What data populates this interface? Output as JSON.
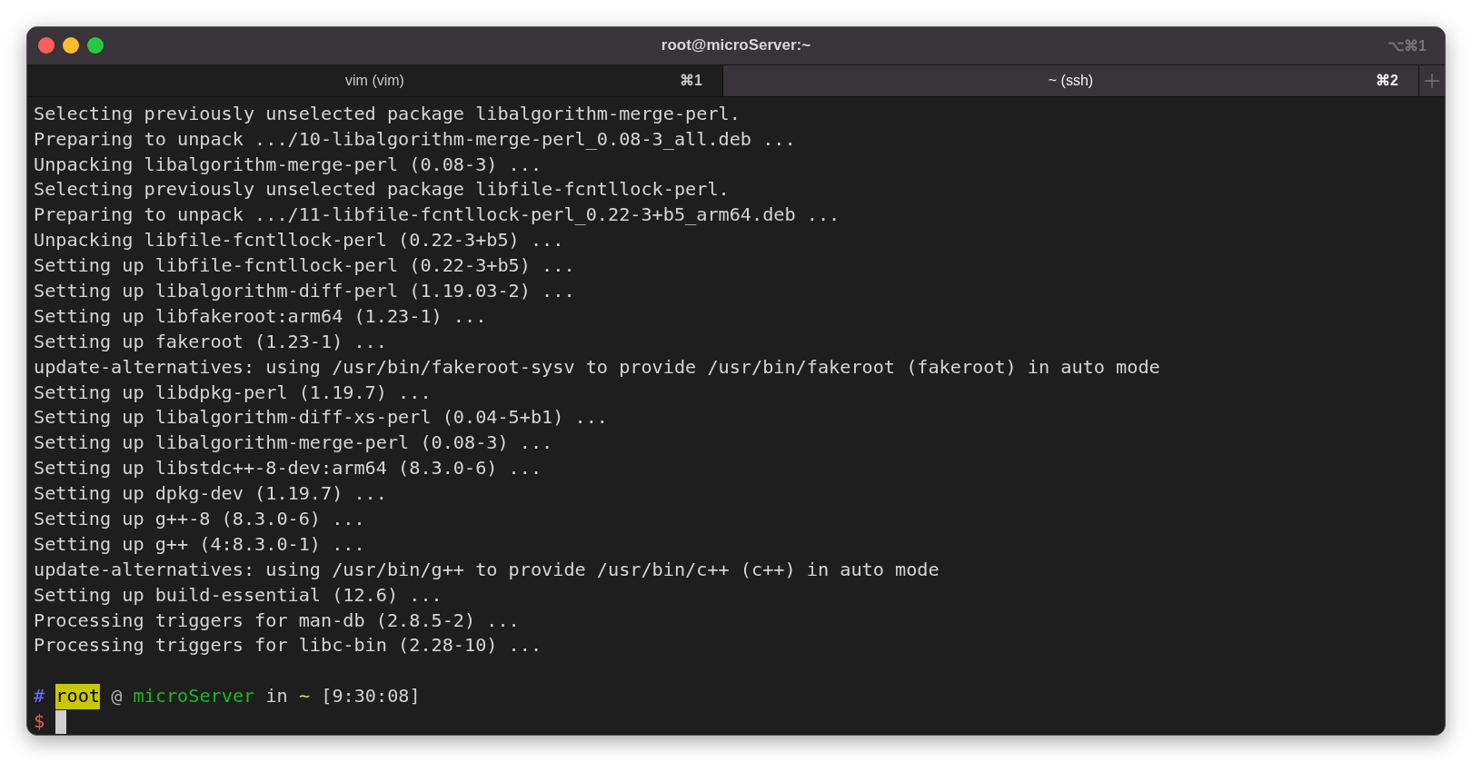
{
  "window": {
    "title": "root@microServer:~",
    "shortcut": "⌥⌘1"
  },
  "tabs": [
    {
      "label": "vim (vim)",
      "shortcut": "⌘1",
      "selected": false
    },
    {
      "label": "~ (ssh)",
      "shortcut": "⌘2",
      "selected": true
    }
  ],
  "output_lines": [
    "Selecting previously unselected package libalgorithm-merge-perl.",
    "Preparing to unpack .../10-libalgorithm-merge-perl_0.08-3_all.deb ...",
    "Unpacking libalgorithm-merge-perl (0.08-3) ...",
    "Selecting previously unselected package libfile-fcntllock-perl.",
    "Preparing to unpack .../11-libfile-fcntllock-perl_0.22-3+b5_arm64.deb ...",
    "Unpacking libfile-fcntllock-perl (0.22-3+b5) ...",
    "Setting up libfile-fcntllock-perl (0.22-3+b5) ...",
    "Setting up libalgorithm-diff-perl (1.19.03-2) ...",
    "Setting up libfakeroot:arm64 (1.23-1) ...",
    "Setting up fakeroot (1.23-1) ...",
    "update-alternatives: using /usr/bin/fakeroot-sysv to provide /usr/bin/fakeroot (fakeroot) in auto mode",
    "Setting up libdpkg-perl (1.19.7) ...",
    "Setting up libalgorithm-diff-xs-perl (0.04-5+b1) ...",
    "Setting up libalgorithm-merge-perl (0.08-3) ...",
    "Setting up libstdc++-8-dev:arm64 (8.3.0-6) ...",
    "Setting up dpkg-dev (1.19.7) ...",
    "Setting up g++-8 (8.3.0-6) ...",
    "Setting up g++ (4:8.3.0-1) ...",
    "update-alternatives: using /usr/bin/g++ to provide /usr/bin/c++ (c++) in auto mode",
    "Setting up build-essential (12.6) ...",
    "Processing triggers for man-db (2.8.5-2) ...",
    "Processing triggers for libc-bin (2.28-10) ..."
  ],
  "prompt": [
    {
      "text": "#",
      "color": "#6d6dff",
      "highlight": false
    },
    {
      "text": "root",
      "color": "#c8c800",
      "highlight": true
    },
    {
      "text": "@",
      "color": "#b4b4b4",
      "highlight": false
    },
    {
      "text": "microServer",
      "color": "#1fb81f",
      "highlight": false
    },
    {
      "text": "in",
      "color": "#d0d0d0",
      "highlight": false
    },
    {
      "text": "~",
      "color": "#e6e23c",
      "highlight": false
    },
    {
      "text": "[9:30:08]",
      "color": "#d0d0d0",
      "highlight": false
    }
  ],
  "input_line": {
    "symbol": "$",
    "color": "#f05a5a"
  }
}
